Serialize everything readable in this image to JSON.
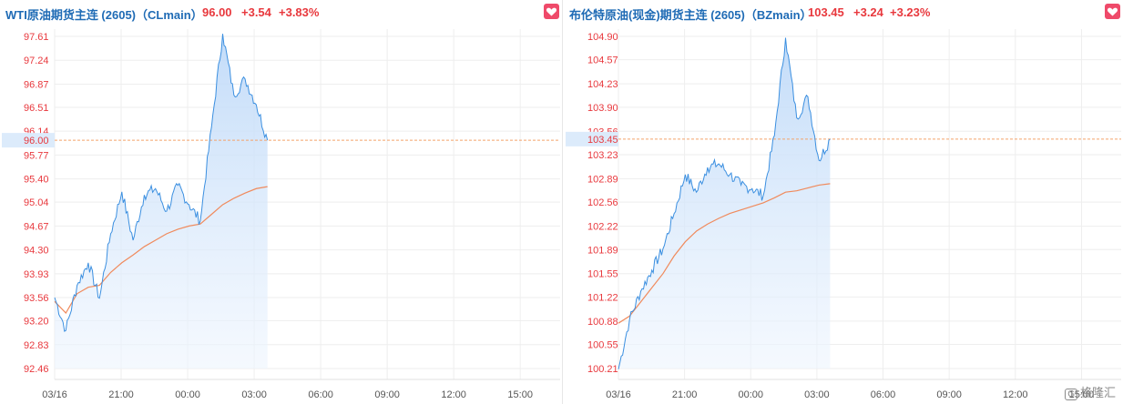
{
  "left": {
    "title": "WTI原油期货主连 (2605)（CLmain）",
    "price": "96.00",
    "change": "+3.54",
    "change_pct": "+3.83%",
    "favorite_icon": "heart-icon"
  },
  "right": {
    "title": "布伦特原油(现金)期货主连 (2605)（BZmain）",
    "price": "103.45",
    "change": "+3.24",
    "change_pct": "+3.23%",
    "favorite_icon": "heart-icon"
  },
  "watermark": "格隆汇",
  "colors": {
    "title": "#1f6bb5",
    "up": "#e8383d",
    "price_line": "#3b8fe0",
    "avg_line": "#f08a5c",
    "fill": "#cfe3fb",
    "grid": "#eeeeee",
    "ref_line": "#f4a26b",
    "favorite": "#ef4a6a"
  },
  "chart_data": [
    {
      "type": "line",
      "yticks": [
        "97.61",
        "97.24",
        "96.87",
        "96.51",
        "96.14",
        "95.77",
        "95.40",
        "95.04",
        "94.67",
        "94.30",
        "93.93",
        "93.56",
        "93.20",
        "92.83",
        "92.46"
      ],
      "xticks": [
        "03/16",
        "21:00",
        "00:00",
        "03:00",
        "06:00",
        "09:00",
        "12:00",
        "15:00"
      ],
      "ylim": [
        92.46,
        97.61
      ],
      "current": "96.00",
      "x": [
        "03/16",
        "18:30",
        "19:00",
        "19:30",
        "20:00",
        "20:30",
        "21:00",
        "21:30",
        "22:00",
        "22:30",
        "23:00",
        "23:30",
        "00:00",
        "00:30",
        "01:00",
        "01:30",
        "02:00",
        "02:30",
        "03:00",
        "03:10"
      ],
      "series": [
        {
          "values": [
            93.56,
            93.05,
            93.75,
            94.1,
            93.55,
            94.55,
            95.2,
            94.45,
            95.15,
            95.25,
            94.9,
            95.3,
            95.0,
            94.75,
            96.2,
            97.65,
            96.7,
            96.95,
            96.55,
            96.0
          ]
        },
        {
          "values": [
            93.5,
            93.32,
            93.62,
            93.72,
            93.75,
            93.95,
            94.1,
            94.22,
            94.35,
            94.45,
            94.55,
            94.62,
            94.67,
            94.7,
            94.85,
            95.0,
            95.1,
            95.18,
            95.25,
            95.28
          ]
        }
      ]
    },
    {
      "type": "line",
      "yticks": [
        "104.90",
        "104.57",
        "104.23",
        "103.90",
        "103.56",
        "103.23",
        "102.89",
        "102.56",
        "102.22",
        "101.89",
        "101.55",
        "101.22",
        "100.88",
        "100.55",
        "100.21"
      ],
      "xticks": [
        "03/16",
        "21:00",
        "00:00",
        "03:00",
        "06:00",
        "09:00",
        "12:00",
        "15:00"
      ],
      "ylim": [
        100.21,
        104.9
      ],
      "current": "103.45",
      "x": [
        "03/16",
        "18:30",
        "19:00",
        "19:30",
        "20:00",
        "20:30",
        "21:00",
        "21:30",
        "22:00",
        "22:30",
        "23:00",
        "23:30",
        "00:00",
        "00:30",
        "01:00",
        "01:30",
        "02:00",
        "02:30",
        "03:00",
        "03:10"
      ],
      "series": [
        {
          "values": [
            100.2,
            100.9,
            101.3,
            101.6,
            101.9,
            102.4,
            102.95,
            102.7,
            103.05,
            103.1,
            102.95,
            102.8,
            102.75,
            102.65,
            103.5,
            104.88,
            103.75,
            104.05,
            103.15,
            103.45
          ]
        },
        {
          "values": [
            100.85,
            100.95,
            101.15,
            101.35,
            101.55,
            101.8,
            102.0,
            102.15,
            102.25,
            102.33,
            102.4,
            102.45,
            102.5,
            102.55,
            102.62,
            102.7,
            102.72,
            102.76,
            102.8,
            102.82
          ]
        }
      ]
    }
  ]
}
